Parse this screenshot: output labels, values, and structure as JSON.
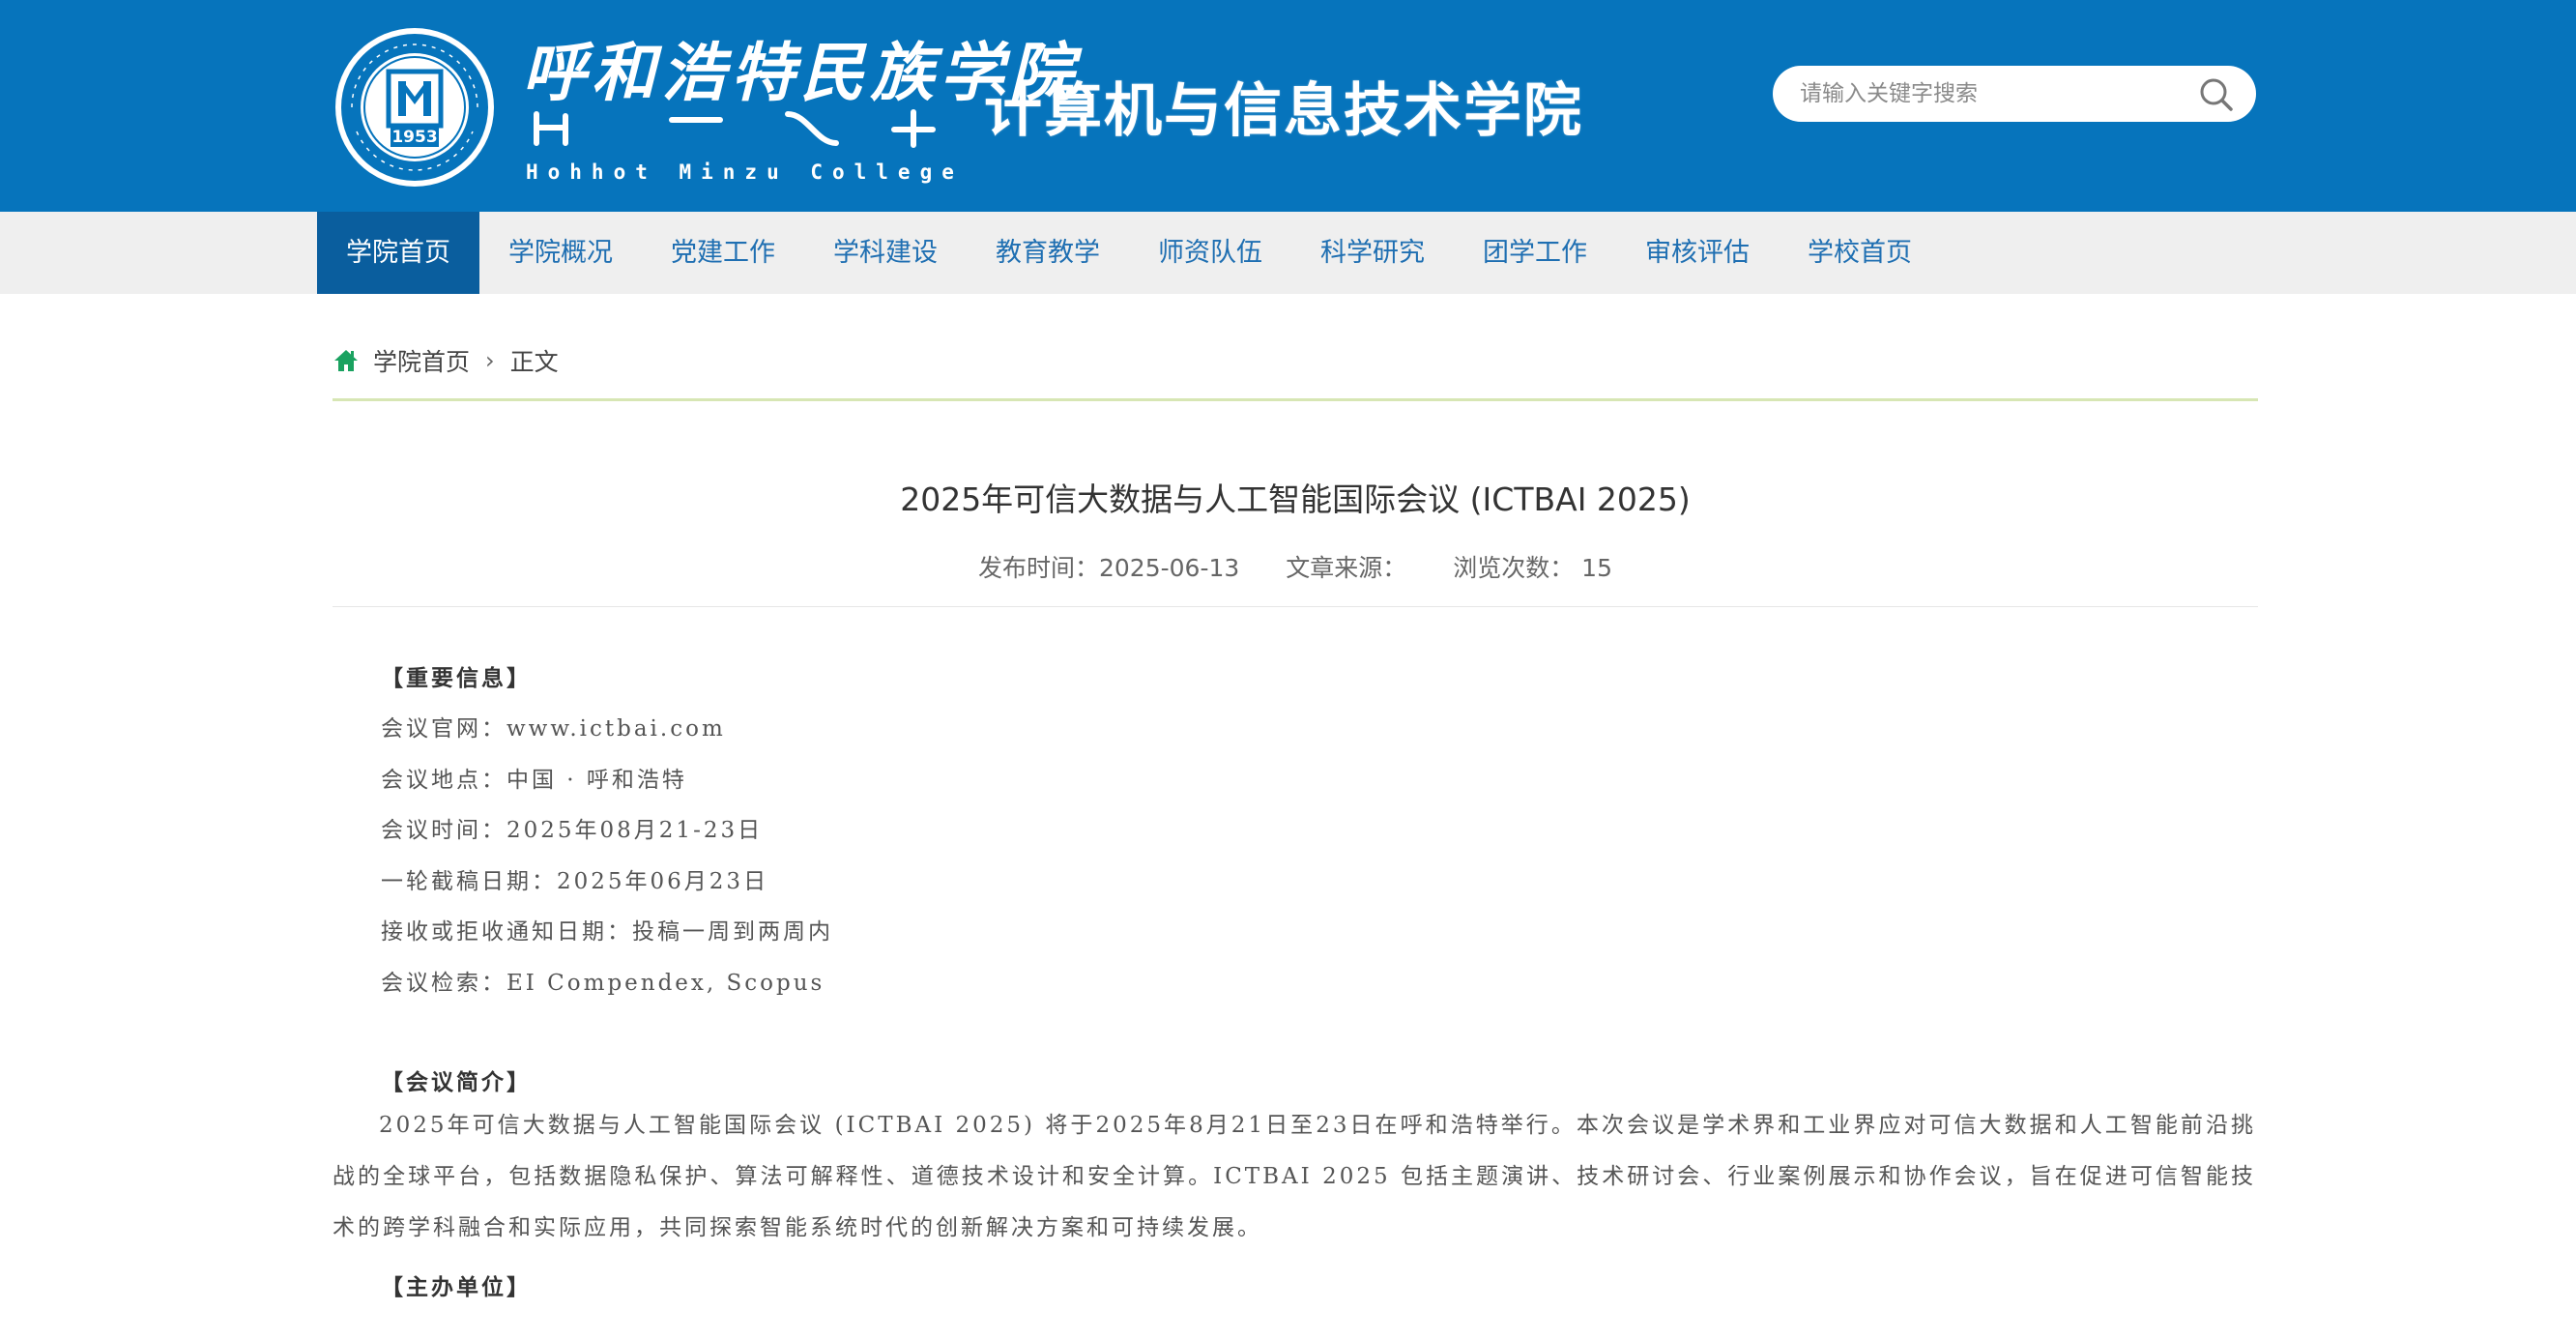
{
  "header": {
    "college_name_cn": "呼和浩特民族学院",
    "college_name_en": "Hohhot Minzu College",
    "logo_year": "1953",
    "school_name": "计算机与信息技术学院",
    "search": {
      "placeholder": "请输入关键字搜索",
      "icon": "search-icon"
    }
  },
  "nav": {
    "items": [
      {
        "label": "学院首页",
        "active": true
      },
      {
        "label": "学院概况"
      },
      {
        "label": "党建工作"
      },
      {
        "label": "学科建设"
      },
      {
        "label": "教育教学"
      },
      {
        "label": "师资队伍"
      },
      {
        "label": "科学研究"
      },
      {
        "label": "团学工作"
      },
      {
        "label": "审核评估"
      },
      {
        "label": "学校首页"
      }
    ]
  },
  "breadcrumb": {
    "home": "学院首页",
    "separator": "›",
    "current": "正文",
    "icon": "home-icon"
  },
  "article": {
    "title": "2025年可信大数据与人工智能国际会议 (ICTBAI 2025)",
    "meta": {
      "publish": "发布时间：2025-06-13",
      "source": "文章来源：",
      "views": "浏览次数：  15"
    },
    "important_head": "【重要信息】",
    "info": [
      "会议官网：www.ictbai.com",
      "会议地点：中国 · 呼和浩特",
      "会议时间：2025年08月21-23日",
      "一轮截稿日期：2025年06月23日",
      "接收或拒收通知日期：投稿一周到两周内",
      "会议检索：EI Compendex, Scopus"
    ],
    "intro_head": "【会议简介】",
    "intro": "2025年可信大数据与人工智能国际会议 (ICTBAI 2025) 将于2025年8月21日至23日在呼和浩特举行。本次会议是学术界和工业界应对可信大数据和人工智能前沿挑战的全球平台，包括数据隐私保护、算法可解释性、道德技术设计和安全计算。ICTBAI 2025 包括主题演讲、技术研讨会、行业案例展示和协作会议，旨在促进可信智能技术的跨学科融合和实际应用，共同探索智能系统时代的创新解决方案和可持续发展。",
    "organizer_head": "【主办单位】"
  },
  "colors": {
    "header_bg": "#0674bc",
    "nav_bg": "#efefef",
    "nav_active": "#0a5e9e",
    "nav_text": "#1f6fb2",
    "home_icon": "#1aa260",
    "rule": "#d7e6b4"
  }
}
